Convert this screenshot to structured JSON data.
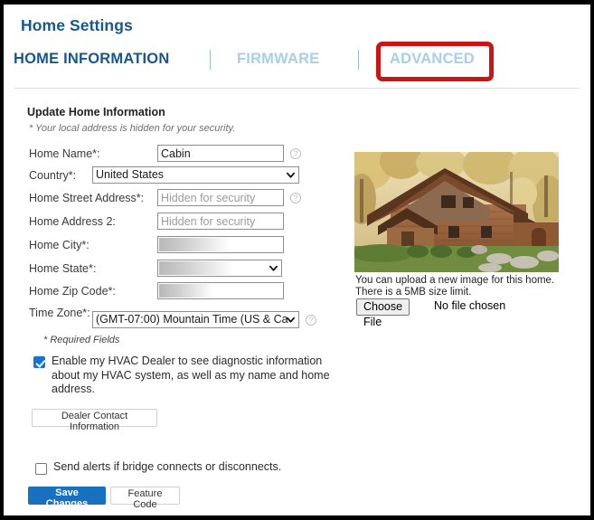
{
  "window": {
    "title": "Home Settings"
  },
  "tabs": [
    {
      "label": "HOME INFORMATION",
      "state": "active"
    },
    {
      "label": "FIRMWARE",
      "state": "inactive"
    },
    {
      "label": "ADVANCED",
      "state": "inactive",
      "highlighted": true
    }
  ],
  "form": {
    "heading": "Update Home Information",
    "subnote": "* Your local address is hidden for your security.",
    "required_note": "* Required Fields",
    "fields": [
      {
        "label": "Home Name*:",
        "type": "text",
        "value": "Cabin",
        "placeholder": "",
        "help": true,
        "redacted": false
      },
      {
        "label": "Country*:",
        "type": "select",
        "value": "United States",
        "help": false,
        "redacted": false
      },
      {
        "label": "Home Street Address*:",
        "type": "text",
        "value": "",
        "placeholder": "Hidden for security",
        "help": true,
        "redacted": false
      },
      {
        "label": "Home Address 2:",
        "type": "text",
        "value": "",
        "placeholder": "Hidden for security",
        "help": false,
        "redacted": false
      },
      {
        "label": "Home City*:",
        "type": "text",
        "value": "",
        "placeholder": "",
        "help": false,
        "redacted": true
      },
      {
        "label": "Home State*:",
        "type": "select",
        "value": "",
        "help": false,
        "redacted": true
      },
      {
        "label": "Home Zip Code*:",
        "type": "text",
        "value": "",
        "placeholder": "",
        "help": false,
        "redacted": true
      },
      {
        "label": "Time Zone*:",
        "type": "select",
        "value": "(GMT-07:00) Mountain Time (US & Ca",
        "help": true,
        "redacted": false
      }
    ]
  },
  "consent": {
    "checked": true,
    "text": "Enable my HVAC Dealer to see diagnostic information about my HVAC system, as well as my name and home address."
  },
  "dealer_button": {
    "label": "Dealer Contact Information"
  },
  "alerts": {
    "checked": false,
    "text": "Send alerts if bridge connects or disconnects."
  },
  "actions": {
    "save_label": "Save Changes",
    "feature_label": "Feature Code"
  },
  "photo_panel": {
    "alt": "photo of a wooden log cabin home with autumn trees",
    "upload_note_line1": "You can upload a new image for this home.",
    "upload_note_line2": "There is a 5MB size limit.",
    "choose_file_label": "Choose File",
    "no_file_label": "No file chosen"
  },
  "icons": {
    "help": "?",
    "chevron_down": "chevron-down-icon"
  },
  "colors": {
    "brand_blue": "#18578e",
    "tab_inactive": "#a9cfe8",
    "highlight_red": "#cc1414",
    "primary_button": "#1771c0",
    "checkbox_blue": "#1673d2"
  }
}
